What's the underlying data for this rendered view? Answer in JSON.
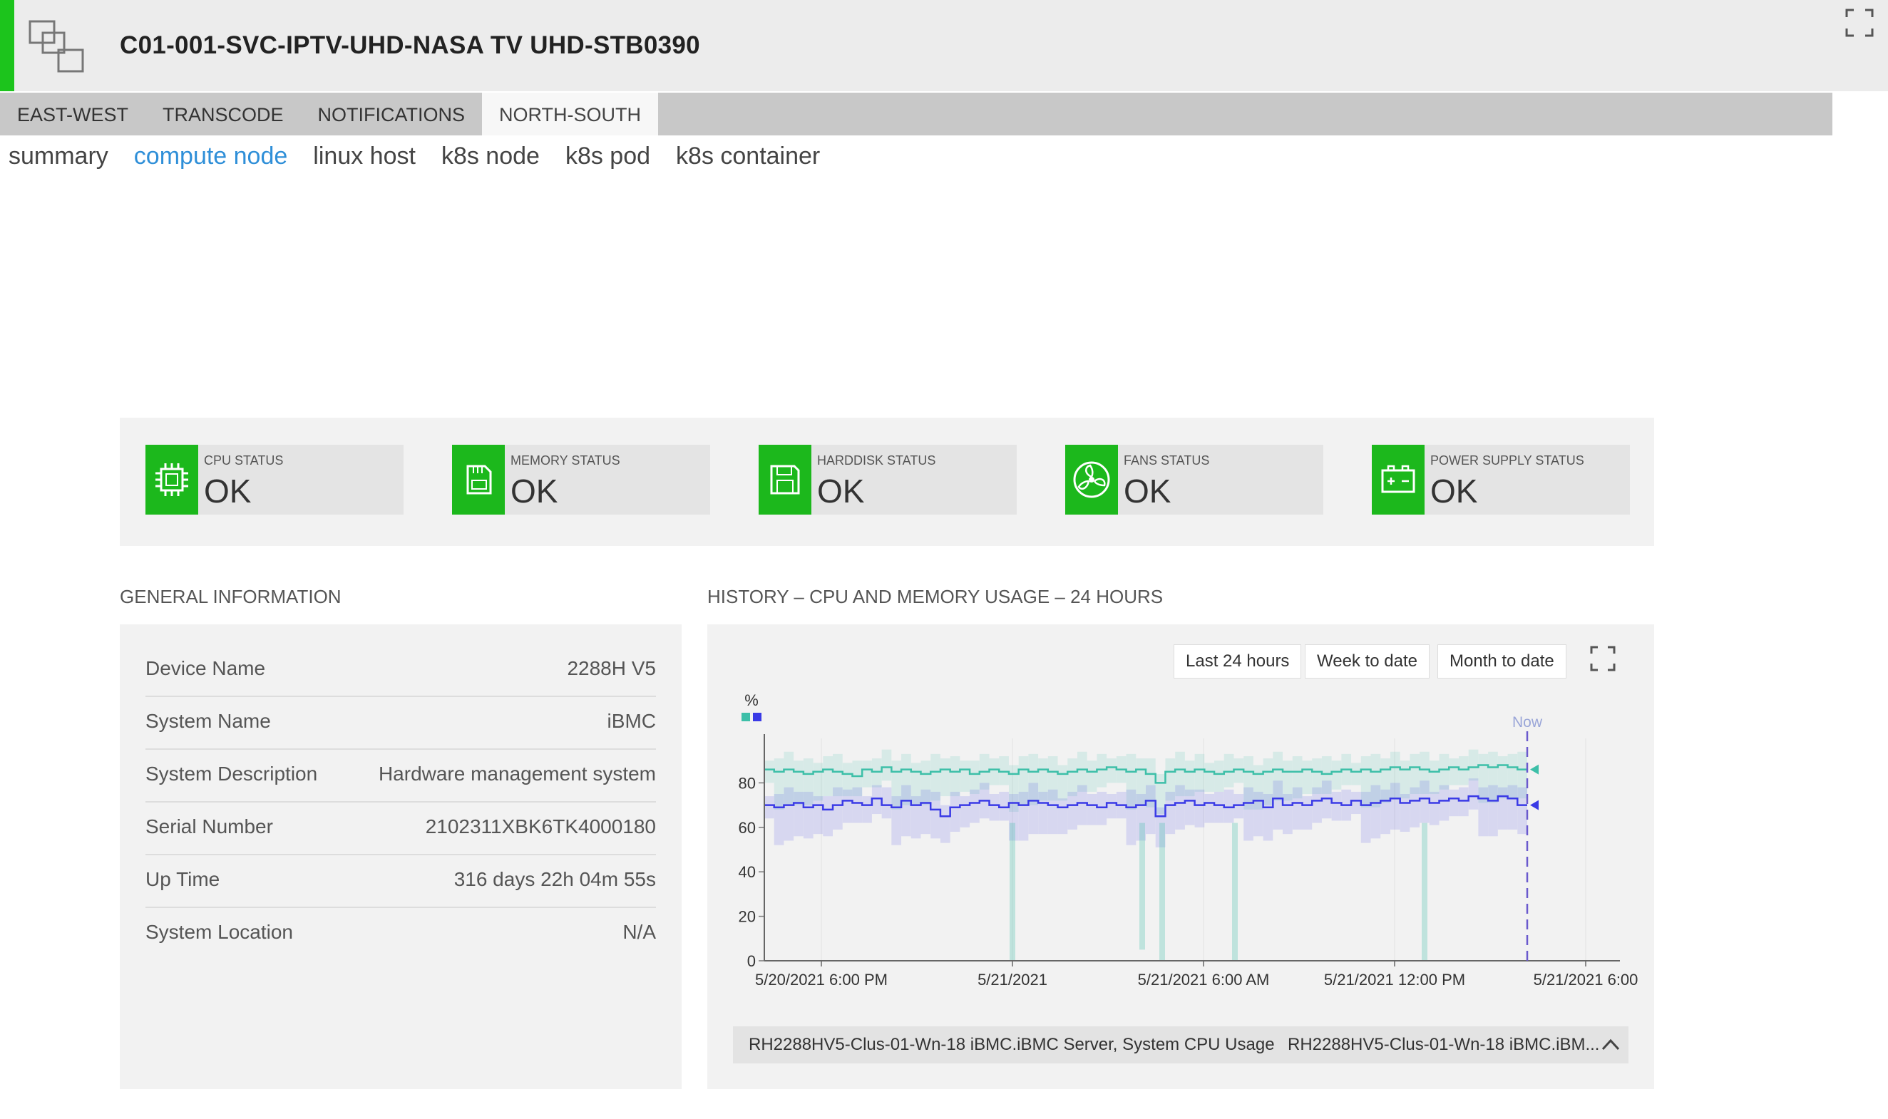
{
  "header": {
    "title": "C01-001-SVC-IPTV-UHD-NASA TV UHD-STB0390"
  },
  "tabs": [
    {
      "label": "EAST-WEST"
    },
    {
      "label": "TRANSCODE"
    },
    {
      "label": "NOTIFICATIONS"
    },
    {
      "label": "NORTH-SOUTH"
    }
  ],
  "subnav": [
    {
      "label": "summary"
    },
    {
      "label": "compute node"
    },
    {
      "label": "linux host"
    },
    {
      "label": "k8s node"
    },
    {
      "label": "k8s pod"
    },
    {
      "label": "k8s container"
    }
  ],
  "status_cards": [
    {
      "label": "CPU STATUS",
      "value": "OK",
      "icon": "cpu-icon"
    },
    {
      "label": "MEMORY STATUS",
      "value": "OK",
      "icon": "memory-icon"
    },
    {
      "label": "HARDDISK STATUS",
      "value": "OK",
      "icon": "harddisk-icon"
    },
    {
      "label": "FANS STATUS",
      "value": "OK",
      "icon": "fan-icon"
    },
    {
      "label": "POWER SUPPLY STATUS",
      "value": "OK",
      "icon": "power-supply-icon"
    }
  ],
  "general_info": {
    "title": "GENERAL INFORMATION",
    "rows": [
      {
        "key": "Device Name",
        "value": "2288H V5"
      },
      {
        "key": "System Name",
        "value": "iBMC"
      },
      {
        "key": "System Description",
        "value": "Hardware management system"
      },
      {
        "key": "Serial Number",
        "value": "2102311XBK6TK4000180"
      },
      {
        "key": "Up Time",
        "value": "316 days 22h 04m 55s"
      },
      {
        "key": "System Location",
        "value": "N/A"
      }
    ]
  },
  "history": {
    "title": "HISTORY – CPU AND MEMORY USAGE – 24 HOURS",
    "range_buttons": [
      "Last 24 hours",
      "Week to date",
      "Month to date"
    ],
    "legend": [
      "RH2288HV5-Clus-01-Wn-18 iBMC.iBMC Server, System CPU Usage",
      "RH2288HV5-Clus-01-Wn-18 iBMC.iBM..."
    ]
  },
  "colors": {
    "accent": "#1cc41c",
    "cpu_series": "#3dbfa8",
    "mem_series": "#3a3ae6",
    "link": "#2f8fd8"
  },
  "chart_data": {
    "type": "line",
    "ylabel": "%",
    "ylim": [
      0,
      100
    ],
    "yticks": [
      0,
      20,
      40,
      60,
      80
    ],
    "xticks": [
      "5/20/2021 6:00 PM",
      "5/21/2021",
      "5/21/2021 6:00 AM",
      "5/21/2021 12:00 PM",
      "5/21/2021 6:00"
    ],
    "now_label": "Now",
    "series": [
      {
        "color": "#3dbfa8",
        "values": [
          86,
          85,
          86,
          85,
          84,
          85,
          86,
          85,
          84,
          83,
          86,
          85,
          87,
          85,
          86,
          85,
          84,
          85,
          86,
          85,
          86,
          84,
          85,
          86,
          85,
          84,
          86,
          85,
          86,
          85,
          84,
          85,
          86,
          85,
          86,
          87,
          86,
          85,
          86,
          84,
          80,
          85,
          86,
          85,
          86,
          85,
          84,
          85,
          86,
          85,
          84,
          85,
          86,
          85,
          85,
          86,
          85,
          84,
          85,
          86,
          85,
          86,
          85,
          86,
          87,
          86,
          87,
          86,
          85,
          86,
          87,
          86,
          87,
          88,
          87,
          88,
          87,
          86
        ]
      },
      {
        "color": "#3a3ae6",
        "values": [
          70,
          69,
          70,
          71,
          69,
          70,
          68,
          70,
          72,
          71,
          70,
          73,
          70,
          69,
          72,
          70,
          71,
          68,
          65,
          69,
          70,
          71,
          72,
          70,
          69,
          71,
          70,
          72,
          71,
          70,
          69,
          70,
          71,
          70,
          69,
          71,
          70,
          69,
          70,
          72,
          65,
          70,
          71,
          72,
          70,
          71,
          70,
          69,
          70,
          71,
          72,
          69,
          73,
          70,
          71,
          70,
          72,
          73,
          71,
          70,
          72,
          70,
          71,
          72,
          73,
          71,
          72,
          73,
          71,
          72,
          73,
          72,
          74,
          73,
          72,
          74,
          73,
          70
        ]
      }
    ]
  }
}
